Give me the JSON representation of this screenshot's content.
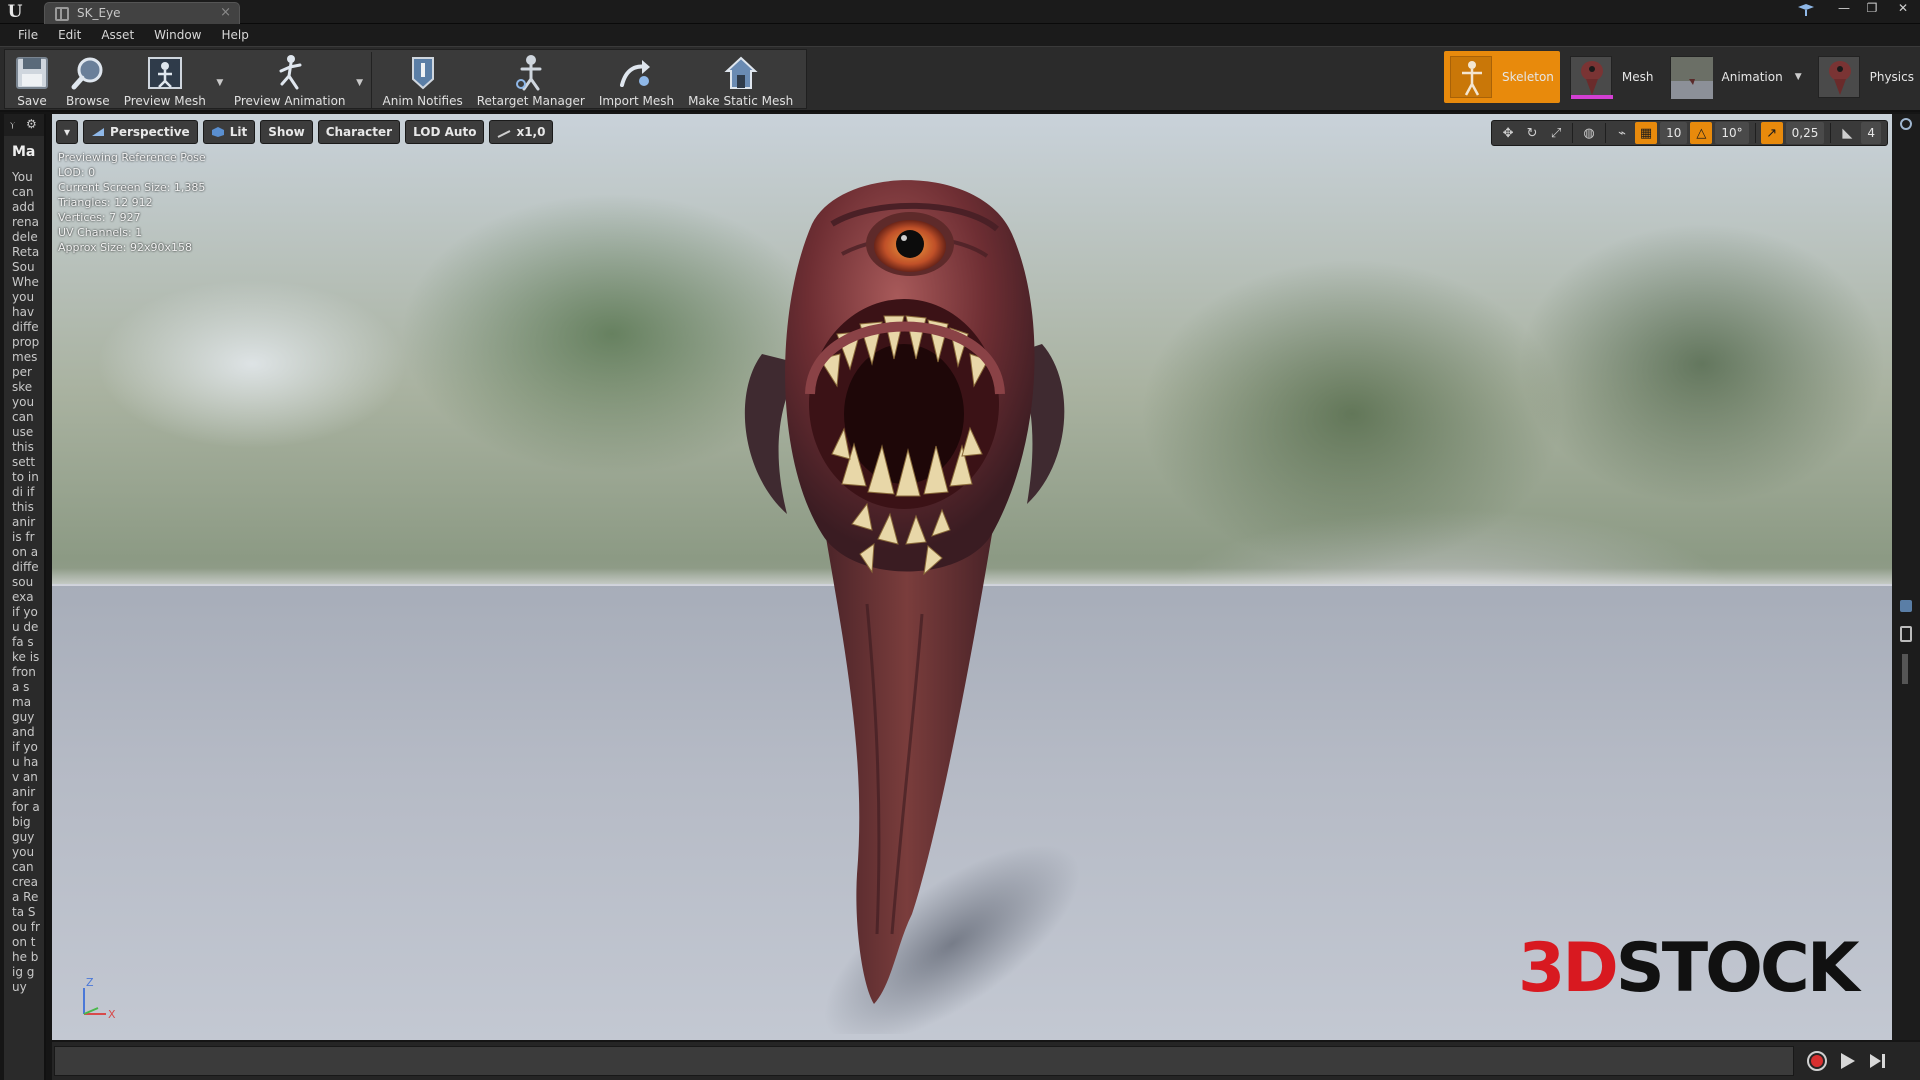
{
  "window": {
    "tab_title": "SK_Eye",
    "tab_close": "×",
    "controls": {
      "minimize": "—",
      "maximize": "❐",
      "close": "✕"
    }
  },
  "menu": [
    "File",
    "Edit",
    "Asset",
    "Window",
    "Help"
  ],
  "toolbar": {
    "buttons": {
      "save": "Save",
      "browse": "Browse",
      "preview_mesh": "Preview Mesh",
      "preview_animation": "Preview Animation",
      "anim_notifies": "Anim Notifies",
      "retarget_manager": "Retarget Manager",
      "import_mesh": "Import Mesh",
      "make_static_mesh": "Make Static Mesh"
    },
    "modes": {
      "skeleton": "Skeleton",
      "mesh": "Mesh",
      "animation": "Animation",
      "physics": "Physics"
    },
    "active_mode": "Skeleton"
  },
  "left_panel": {
    "title": "Ma",
    "description": "You can add rena dele Reta Sou Whe you hav diffe prop mes per ske you can use this sett to indi if this anir is fron a diffe sou exa if you defa ske is fron a sma guy and if you hav an anir for a big guy you can crea a Reta Sou fron the big guy"
  },
  "viewport": {
    "toolbar_left": {
      "options_arrow": "▾",
      "perspective": "Perspective",
      "lit": "Lit",
      "show": "Show",
      "character": "Character",
      "lod": "LOD Auto",
      "speed": "x1,0"
    },
    "toolbar_right": {
      "grid_snap": "10",
      "rotation_snap": "10°",
      "scale_snap": "0,25",
      "camera_speed": "4"
    },
    "stats": [
      "Previewing Reference Pose",
      "LOD: 0",
      "Current Screen Size: 1,385",
      "Triangles: 12 912",
      "Vertices: 7 927",
      "UV Channels: 1",
      "Approx Size: 92x90x158"
    ],
    "axes": {
      "z": "Z",
      "x": "X"
    },
    "watermark": {
      "part1": "3D",
      "part2": "STOCK"
    }
  },
  "colors": {
    "accent_orange": "#e88a0c",
    "watermark_red": "#d81920",
    "panel_bg": "#2b2b2b"
  }
}
